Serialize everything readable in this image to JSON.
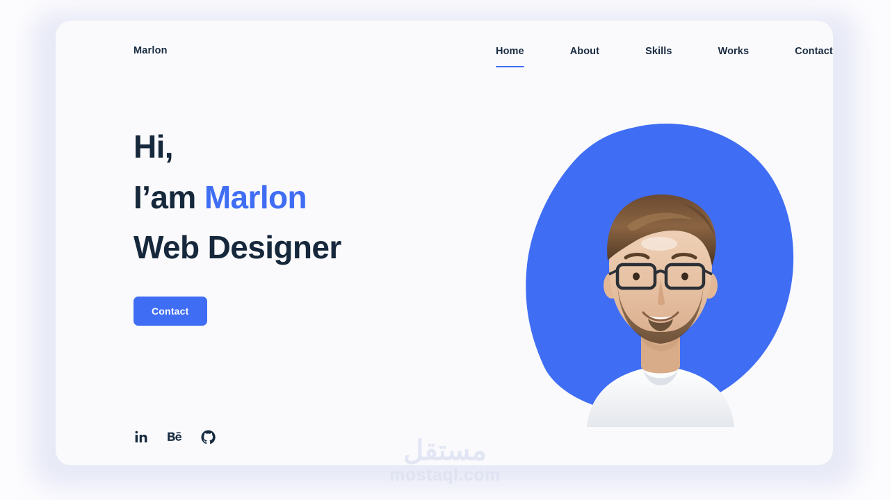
{
  "brand": {
    "name": "Marlon"
  },
  "nav": {
    "items": [
      {
        "label": "Home",
        "active": true
      },
      {
        "label": "About",
        "active": false
      },
      {
        "label": "Skills",
        "active": false
      },
      {
        "label": "Works",
        "active": false
      },
      {
        "label": "Contact",
        "active": false
      }
    ]
  },
  "hero": {
    "line1": "Hi,",
    "line2_prefix": "I’am ",
    "line2_accent": "Marlon",
    "line3": "Web Designer",
    "cta_label": "Contact",
    "portrait_alt": "Portrait photo of a smiling bearded man wearing glasses and a white t-shirt"
  },
  "socials": [
    {
      "name": "linkedin",
      "label": "in"
    },
    {
      "name": "behance",
      "label": "Bē"
    },
    {
      "name": "github",
      "label": "GitHub"
    }
  ],
  "watermark": {
    "arabic": "مستقل",
    "latin": "mostaql.com"
  },
  "colors": {
    "accent_blue": "#3F6DF4",
    "heading_navy": "#16283B",
    "card_background": "#FAFAFC",
    "page_background": "#FCFCFE",
    "glow_lavender": "#E6E8F6",
    "watermark_gray": "#E2E6F4"
  }
}
